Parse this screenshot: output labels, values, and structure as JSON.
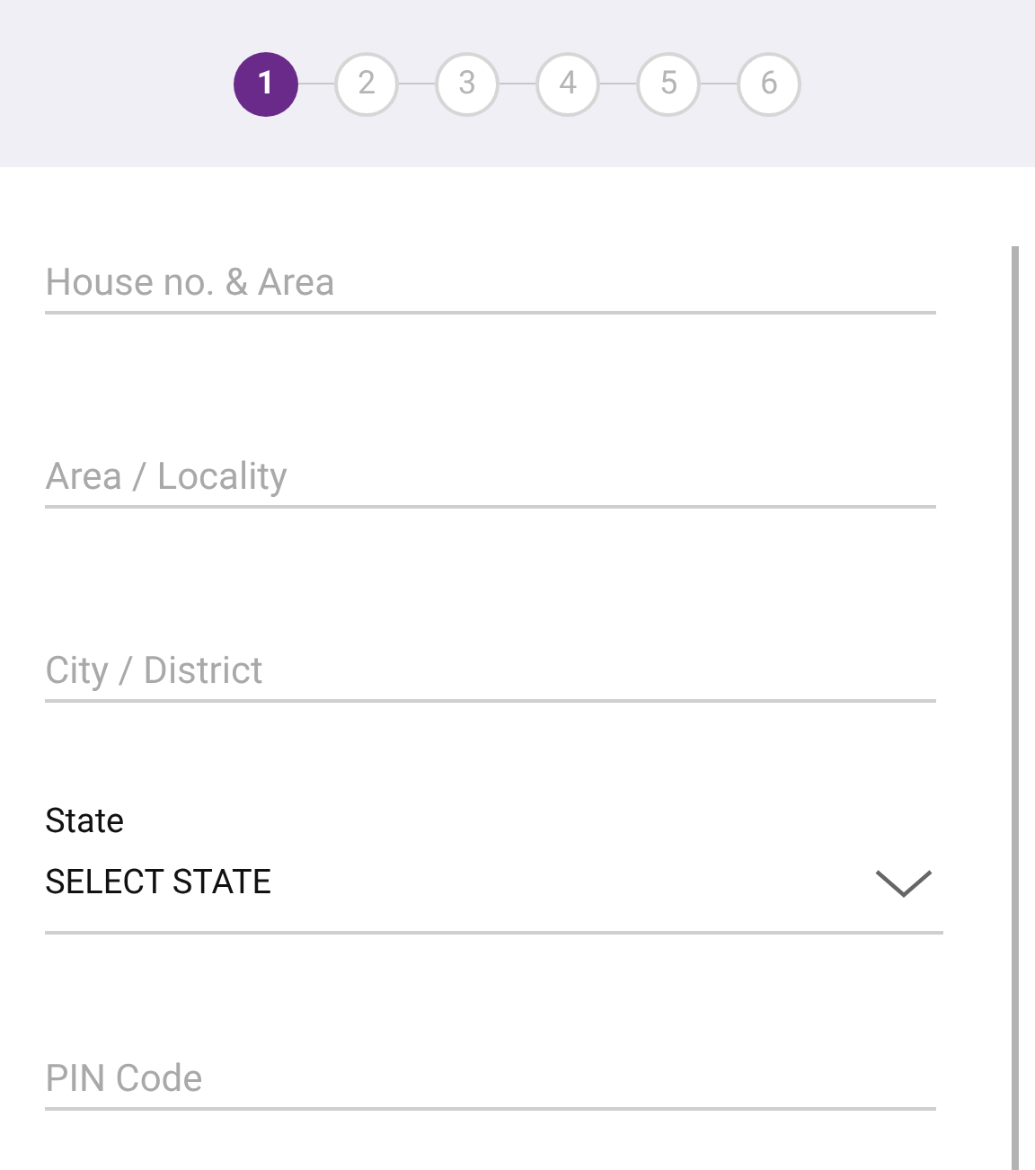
{
  "stepper": {
    "steps": [
      {
        "label": "1",
        "selected": true
      },
      {
        "label": "2",
        "selected": false
      },
      {
        "label": "3",
        "selected": false
      },
      {
        "label": "4",
        "selected": false
      },
      {
        "label": "5",
        "selected": false
      },
      {
        "label": "6",
        "selected": false
      }
    ]
  },
  "fields": [
    {
      "kind": "text",
      "placeholder": "House no. & Area"
    },
    {
      "kind": "text",
      "placeholder": "Area / Locality"
    },
    {
      "kind": "text",
      "placeholder": "City / District"
    },
    {
      "kind": "select",
      "label": "State",
      "value": "SELECT STATE"
    },
    {
      "kind": "text",
      "placeholder": "PIN Code"
    }
  ]
}
